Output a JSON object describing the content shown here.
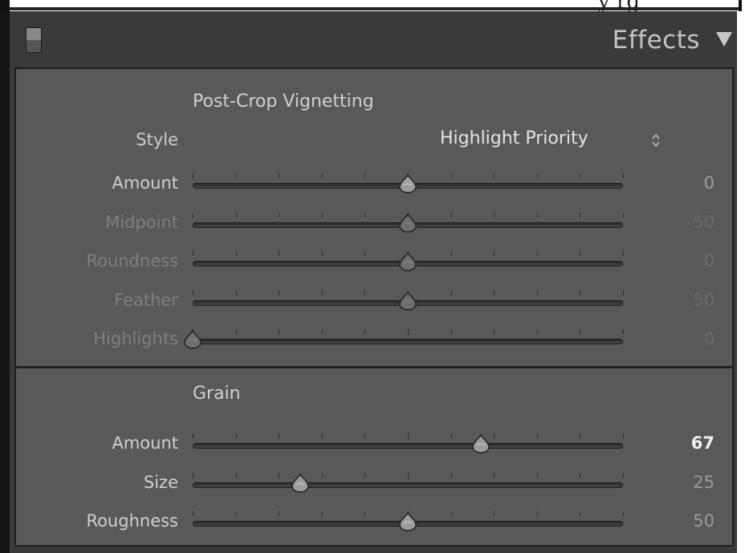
{
  "top_fragment": "y     rg",
  "header": {
    "title": "Effects",
    "switch_icon": "panel-toggle-icon",
    "collapse_icon": "triangle-down-icon"
  },
  "vignette": {
    "title": "Post-Crop Vignetting",
    "style_label": "Style",
    "style_value": "Highlight Priority",
    "rows": [
      {
        "label": "Amount",
        "value": "0",
        "position": 0.5,
        "enabled": true
      },
      {
        "label": "Midpoint",
        "value": "50",
        "position": 0.5,
        "enabled": false
      },
      {
        "label": "Roundness",
        "value": "0",
        "position": 0.5,
        "enabled": false
      },
      {
        "label": "Feather",
        "value": "50",
        "position": 0.5,
        "enabled": false
      },
      {
        "label": "Highlights",
        "value": "0",
        "position": 0.0,
        "enabled": false
      }
    ]
  },
  "grain": {
    "title": "Grain",
    "rows": [
      {
        "label": "Amount",
        "value": "67",
        "position": 0.67,
        "enabled": true,
        "strong": true
      },
      {
        "label": "Size",
        "value": "25",
        "position": 0.25,
        "enabled": true
      },
      {
        "label": "Roughness",
        "value": "50",
        "position": 0.5,
        "enabled": true
      }
    ]
  },
  "colors": {
    "panel_bg": "#3a3a3a",
    "section_bg": "#595959",
    "text": "#cfcfcf"
  }
}
